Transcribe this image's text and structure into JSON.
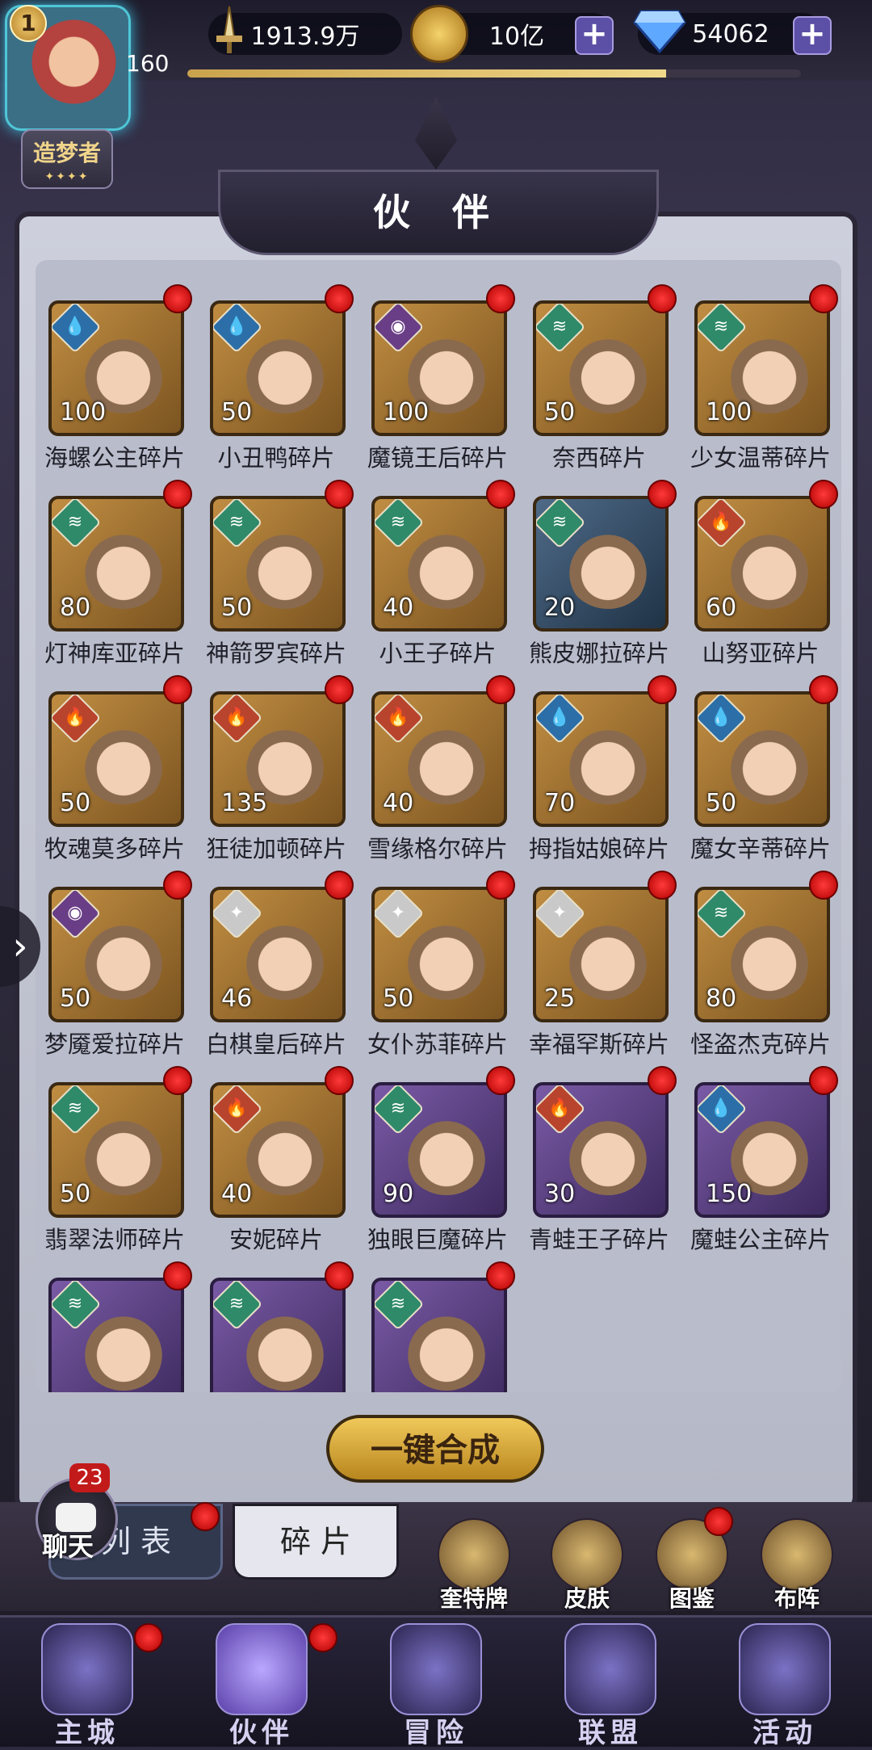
{
  "player": {
    "level": "1",
    "exp_level": "160",
    "title": "造梦者",
    "title_stars": "✦✦✦✦",
    "exp_fraction": 0.78
  },
  "currencies": [
    {
      "name": "power",
      "icon": "sword-icon",
      "value": "1913.9万"
    },
    {
      "name": "gold",
      "icon": "gold-coin-icon",
      "value": "10亿"
    },
    {
      "name": "diamond",
      "icon": "diamond-icon",
      "value": "54062"
    }
  ],
  "panel": {
    "title": "伙 伴"
  },
  "fragments": [
    {
      "name": "海螺公主碎片",
      "count": "100",
      "element": "water",
      "frame": "gold"
    },
    {
      "name": "小丑鸭碎片",
      "count": "50",
      "element": "water",
      "frame": "gold"
    },
    {
      "name": "魔镜王后碎片",
      "count": "100",
      "element": "dark",
      "frame": "gold"
    },
    {
      "name": "奈西碎片",
      "count": "50",
      "element": "wind",
      "frame": "gold"
    },
    {
      "name": "少女温蒂碎片",
      "count": "100",
      "element": "wind",
      "frame": "gold"
    },
    {
      "name": "灯神库亚碎片",
      "count": "80",
      "element": "wind",
      "frame": "gold"
    },
    {
      "name": "神箭罗宾碎片",
      "count": "50",
      "element": "wind",
      "frame": "gold"
    },
    {
      "name": "小王子碎片",
      "count": "40",
      "element": "wind",
      "frame": "gold"
    },
    {
      "name": "熊皮娜拉碎片",
      "count": "20",
      "element": "wind",
      "frame": "blue"
    },
    {
      "name": "山努亚碎片",
      "count": "60",
      "element": "fire",
      "frame": "gold"
    },
    {
      "name": "牧魂莫多碎片",
      "count": "50",
      "element": "fire",
      "frame": "gold"
    },
    {
      "name": "狂徒加顿碎片",
      "count": "135",
      "element": "fire",
      "frame": "gold"
    },
    {
      "name": "雪缘格尔碎片",
      "count": "40",
      "element": "fire",
      "frame": "gold"
    },
    {
      "name": "拇指姑娘碎片",
      "count": "70",
      "element": "water",
      "frame": "gold"
    },
    {
      "name": "魔女辛蒂碎片",
      "count": "50",
      "element": "water",
      "frame": "gold"
    },
    {
      "name": "梦魇爱拉碎片",
      "count": "50",
      "element": "dark",
      "frame": "gold"
    },
    {
      "name": "白棋皇后碎片",
      "count": "46",
      "element": "light",
      "frame": "gold"
    },
    {
      "name": "女仆苏菲碎片",
      "count": "50",
      "element": "light",
      "frame": "gold"
    },
    {
      "name": "幸福罕斯碎片",
      "count": "25",
      "element": "light",
      "frame": "gold"
    },
    {
      "name": "怪盗杰克碎片",
      "count": "80",
      "element": "wind",
      "frame": "gold"
    },
    {
      "name": "翡翠法师碎片",
      "count": "50",
      "element": "wind",
      "frame": "gold"
    },
    {
      "name": "安妮碎片",
      "count": "40",
      "element": "fire",
      "frame": "gold"
    },
    {
      "name": "独眼巨魔碎片",
      "count": "90",
      "element": "wind",
      "frame": "purple"
    },
    {
      "name": "青蛙王子碎片",
      "count": "30",
      "element": "fire",
      "frame": "purple"
    },
    {
      "name": "魔蛙公主碎片",
      "count": "150",
      "element": "water",
      "frame": "purple"
    },
    {
      "name": "",
      "count": "",
      "element": "wind",
      "frame": "purple"
    },
    {
      "name": "",
      "count": "",
      "element": "wind",
      "frame": "purple"
    },
    {
      "name": "",
      "count": "",
      "element": "wind",
      "frame": "purple"
    }
  ],
  "actions": {
    "synthesize_all": "一键合成"
  },
  "tabs": {
    "list": "列 表",
    "fragments": "碎 片"
  },
  "side_buttons": [
    {
      "label": "奎特牌",
      "icon": "card-pack-icon"
    },
    {
      "label": "皮肤",
      "icon": "costume-icon"
    },
    {
      "label": "图鉴",
      "icon": "album-icon"
    },
    {
      "label": "布阵",
      "icon": "formation-icon"
    }
  ],
  "chat": {
    "label": "聊天",
    "badge": "23"
  },
  "bottom_nav": [
    {
      "label": "主城",
      "icon": "castle-icon",
      "badge": true
    },
    {
      "label": "伙伴",
      "icon": "partner-hat-icon",
      "badge": true,
      "active": true
    },
    {
      "label": "冒险",
      "icon": "compass-icon",
      "badge": false
    },
    {
      "label": "联盟",
      "icon": "shield-icon",
      "badge": false
    },
    {
      "label": "活动",
      "icon": "cards-icon",
      "badge": false
    }
  ]
}
